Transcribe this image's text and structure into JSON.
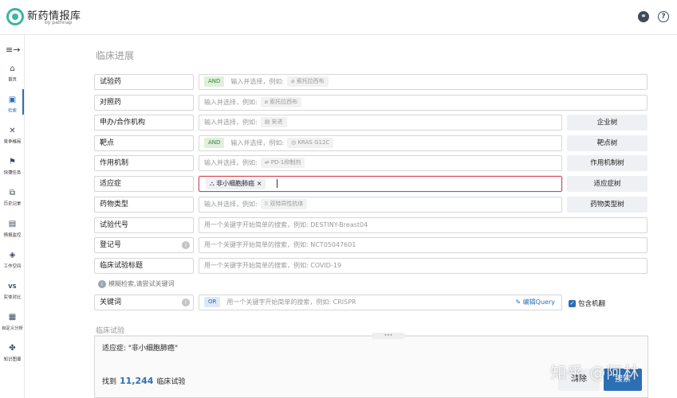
{
  "app": {
    "logo_name": "新药情报库",
    "logo_sub": "by pathnap"
  },
  "header": {
    "link_icon": "link-icon",
    "help_icon": "?"
  },
  "sidebar": {
    "toggle": "≡→",
    "items": [
      {
        "label": "首页",
        "icon": "⌂"
      },
      {
        "label": "检索",
        "icon": "▣"
      },
      {
        "label": "竞争格局",
        "icon": "✕"
      },
      {
        "label": "快捷任务",
        "icon": "⚑"
      },
      {
        "label": "历史记录",
        "icon": "⧉"
      },
      {
        "label": "情报监控",
        "icon": "▤"
      },
      {
        "label": "工作空间",
        "icon": "◈"
      },
      {
        "label": "实体对比",
        "icon": "VS"
      },
      {
        "label": "自定义分析",
        "icon": "▦"
      },
      {
        "label": "知识图谱",
        "icon": "✤"
      }
    ]
  },
  "section_title": "临床进展",
  "fields": [
    {
      "label": "试验药",
      "tag": "AND",
      "placeholder": "输入并选择，例如:",
      "chip": "⌀ 索托拉西布",
      "tree": ""
    },
    {
      "label": "对照药",
      "tag": "",
      "placeholder": "输入并选择，例如:",
      "chip": "⌀ 索托拉西布",
      "tree": ""
    },
    {
      "label": "申办/合作机构",
      "tag": "",
      "placeholder": "输入并选择，例如:",
      "chip": "▤ 安进",
      "tree": "企业树"
    },
    {
      "label": "靶点",
      "tag": "AND",
      "placeholder": "输入并选择，例如:",
      "chip": "◎ KRAS G12C",
      "tree": "靶点树"
    },
    {
      "label": "作用机制",
      "tag": "",
      "placeholder": "输入并选择，例如:",
      "chip": "⇌ PD-1抑制剂",
      "tree": "作用机制树"
    },
    {
      "label": "适应症",
      "tag": "",
      "placeholder": "",
      "chip": "",
      "tree": "适应症树",
      "selected": "⛬ 非小细胞肺癌",
      "remove": "×"
    },
    {
      "label": "药物类型",
      "tag": "",
      "placeholder": "输入并选择，例如:",
      "chip": "⁞⁞ 双特异性抗体",
      "tree": "药物类型树"
    },
    {
      "label": "试验代号",
      "tag": "",
      "placeholder": "用一个关键字开始简单的搜索，例如:   DESTINY-Breast04",
      "chip": "",
      "tree": ""
    },
    {
      "label": "登记号",
      "tag": "",
      "placeholder": "用一个关键字开始简单的搜索，例如:   NCT05047601",
      "chip": "",
      "tree": "",
      "info": "i"
    },
    {
      "label": "临床试验标题",
      "tag": "",
      "placeholder": "用一个关键字开始简单的搜索，例如:   COVID-19",
      "chip": "",
      "tree": ""
    }
  ],
  "hint": {
    "icon": "i",
    "text": "模糊检索,请尝试关键词"
  },
  "keyword": {
    "label": "关键词",
    "info": "i",
    "tag": "OR",
    "placeholder": "用一个关键字开始简单的搜索，例如:   CRISPR",
    "edit": "✎ 编辑Query",
    "checkbox_label": "包含机翻",
    "checkbox_mark": "✓"
  },
  "trials": {
    "title": "临床试验",
    "handle": "•••",
    "filter": "适应症: \"非小细胞肺癌\"",
    "found_prefix": "找到",
    "count": "11,244",
    "found_suffix": "临床试验",
    "clear": "清除",
    "search": "搜索"
  },
  "watermark": "知乎 @阿林"
}
